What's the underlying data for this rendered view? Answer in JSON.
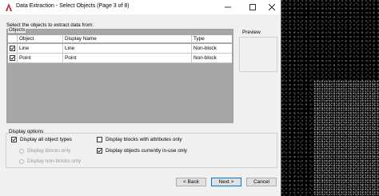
{
  "window": {
    "title": "Data Extraction - Select Objects (Page 3 of 8)",
    "controls": {
      "minimize": "—",
      "maximize": "☐",
      "close": "✕"
    }
  },
  "instruction": "Select the objects to extract data from:",
  "objects": {
    "legend": "Objects",
    "columns": [
      "Object",
      "Display Name",
      "Type"
    ],
    "rows": [
      {
        "checked": true,
        "object": "Line",
        "display_name": "Line",
        "type": "Non-block"
      },
      {
        "checked": true,
        "object": "Point",
        "display_name": "Point",
        "type": "Non-block"
      }
    ]
  },
  "preview": {
    "label": "Preview"
  },
  "display_options": {
    "legend": "Display options",
    "all_object_types": {
      "label": "Display all object types",
      "checked": true
    },
    "blocks_only": {
      "label": "Display blocks only",
      "enabled": false
    },
    "non_blocks_only": {
      "label": "Display non-blocks only",
      "enabled": false
    },
    "blocks_with_attributes": {
      "label": "Display blocks with attributes only",
      "checked": false
    },
    "objects_in_use": {
      "label": "Display objects currently in-use only",
      "checked": true
    }
  },
  "buttons": {
    "back": "< Back",
    "next": "Next >",
    "cancel": "Cancel"
  },
  "colors": {
    "accent": "#0078d7",
    "app_icon": "#c8202f",
    "grid_fill": "#a6a6a6"
  }
}
